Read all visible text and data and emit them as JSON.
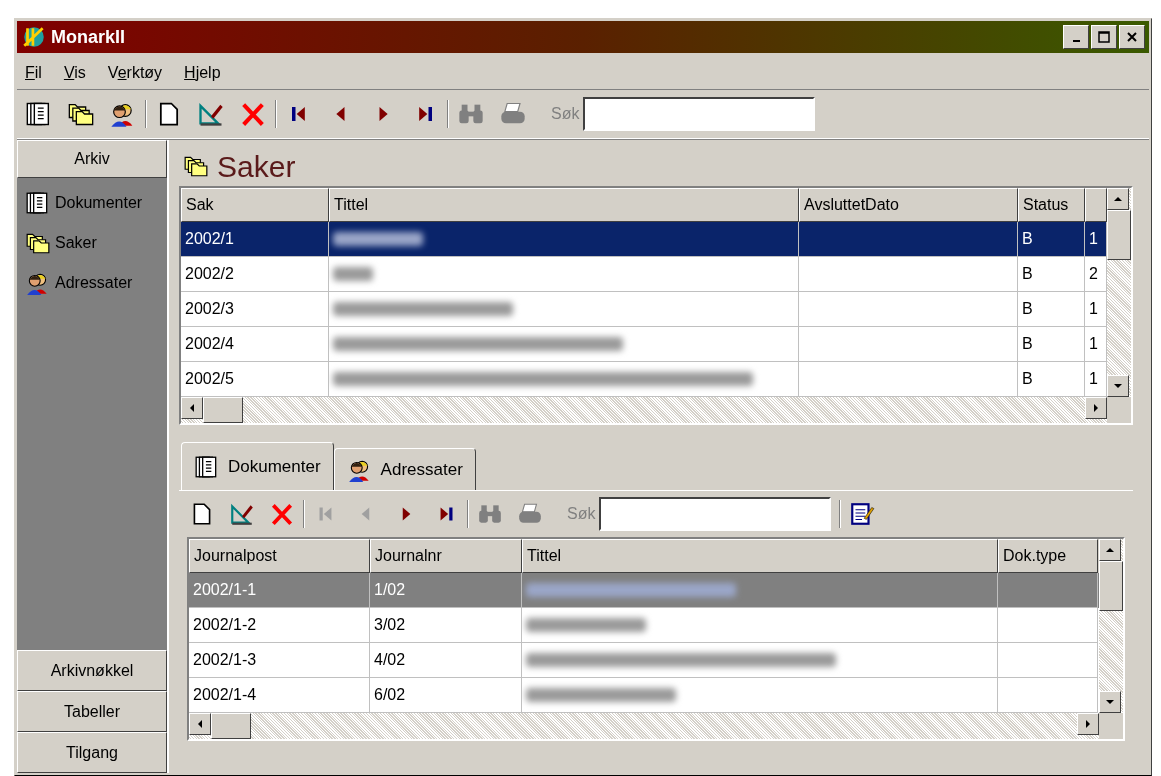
{
  "window": {
    "title": "MonarkII"
  },
  "menu": [
    {
      "mnemonic": "F",
      "label_end": "il"
    },
    {
      "mnemonic": "V",
      "label_end": "is"
    },
    {
      "label_start": "V",
      "mnemonic": "e",
      "label_end": "rktøy"
    },
    {
      "mnemonic": "H",
      "label_end": "jelp"
    }
  ],
  "toolbar": {
    "groups": [
      [
        {
          "kind": "documents",
          "disabled": false
        },
        {
          "kind": "cases",
          "disabled": false
        },
        {
          "kind": "contacts",
          "disabled": false
        }
      ],
      [
        {
          "kind": "new",
          "disabled": false
        },
        {
          "kind": "edit",
          "disabled": false
        },
        {
          "kind": "delete",
          "disabled": false
        }
      ],
      [
        {
          "kind": "first",
          "disabled": false
        },
        {
          "kind": "prev",
          "disabled": false
        },
        {
          "kind": "next",
          "disabled": false
        },
        {
          "kind": "last",
          "disabled": false
        }
      ],
      [
        {
          "kind": "find",
          "disabled": true
        },
        {
          "kind": "print",
          "disabled": true
        }
      ]
    ],
    "search": {
      "label": "Søk",
      "disabled": true
    }
  },
  "sidebar": {
    "header": "Arkiv",
    "items": [
      {
        "label": "Dokumenter",
        "kind": "documents"
      },
      {
        "label": "Saker",
        "kind": "cases"
      },
      {
        "label": "Adressater",
        "kind": "contacts"
      }
    ],
    "sections": [
      "Arkivnøkkel",
      "Tabeller",
      "Tilgang"
    ]
  },
  "main": {
    "title": "Saker",
    "kind": "cases"
  },
  "cases_table": {
    "focused": true,
    "columns": [
      "Sak",
      "Tittel",
      "AvsluttetDato",
      "Status"
    ],
    "rows": [
      {
        "sak": "2002/1",
        "status": "B",
        "column_5": "1",
        "selected": true
      },
      {
        "sak": "2002/2",
        "status": "B",
        "column_5": "2",
        "selected": false
      },
      {
        "sak": "2002/3",
        "status": "B",
        "column_5": "1",
        "selected": false
      },
      {
        "sak": "2002/4",
        "status": "B",
        "column_5": "1",
        "selected": false
      },
      {
        "sak": "2002/5",
        "status": "B",
        "column_5": "1",
        "selected": false
      }
    ]
  },
  "tabs": [
    {
      "label": "Dokumenter",
      "kind": "documents",
      "selected": true
    },
    {
      "label": "Adressater",
      "kind": "contacts",
      "selected": false
    }
  ],
  "sub_toolbar": {
    "groups": [
      [
        {
          "kind": "new",
          "disabled": false
        },
        {
          "kind": "edit",
          "disabled": false
        },
        {
          "kind": "delete",
          "disabled": false
        }
      ],
      [
        {
          "kind": "first",
          "disabled": true
        },
        {
          "kind": "prev",
          "disabled": true
        },
        {
          "kind": "next",
          "disabled": false
        },
        {
          "kind": "last",
          "disabled": false
        }
      ],
      [
        {
          "kind": "find",
          "disabled": true
        },
        {
          "kind": "print",
          "disabled": true
        }
      ]
    ],
    "search": {
      "label": "Søk",
      "disabled": true
    },
    "extra": [
      {
        "kind": "notes",
        "disabled": false
      }
    ]
  },
  "documents_table": {
    "focused": false,
    "columns": [
      "Journalpost",
      "Journalnr",
      "Tittel",
      "Dok.type"
    ],
    "rows": [
      {
        "journalpost": "2002/1-1",
        "journalnr": "1/02",
        "selected": true
      },
      {
        "journalpost": "2002/1-2",
        "journalnr": "3/02",
        "selected": false
      },
      {
        "journalpost": "2002/1-3",
        "journalnr": "4/02",
        "selected": false
      },
      {
        "journalpost": "2002/1-4",
        "journalnr": "6/02",
        "selected": false
      }
    ]
  }
}
